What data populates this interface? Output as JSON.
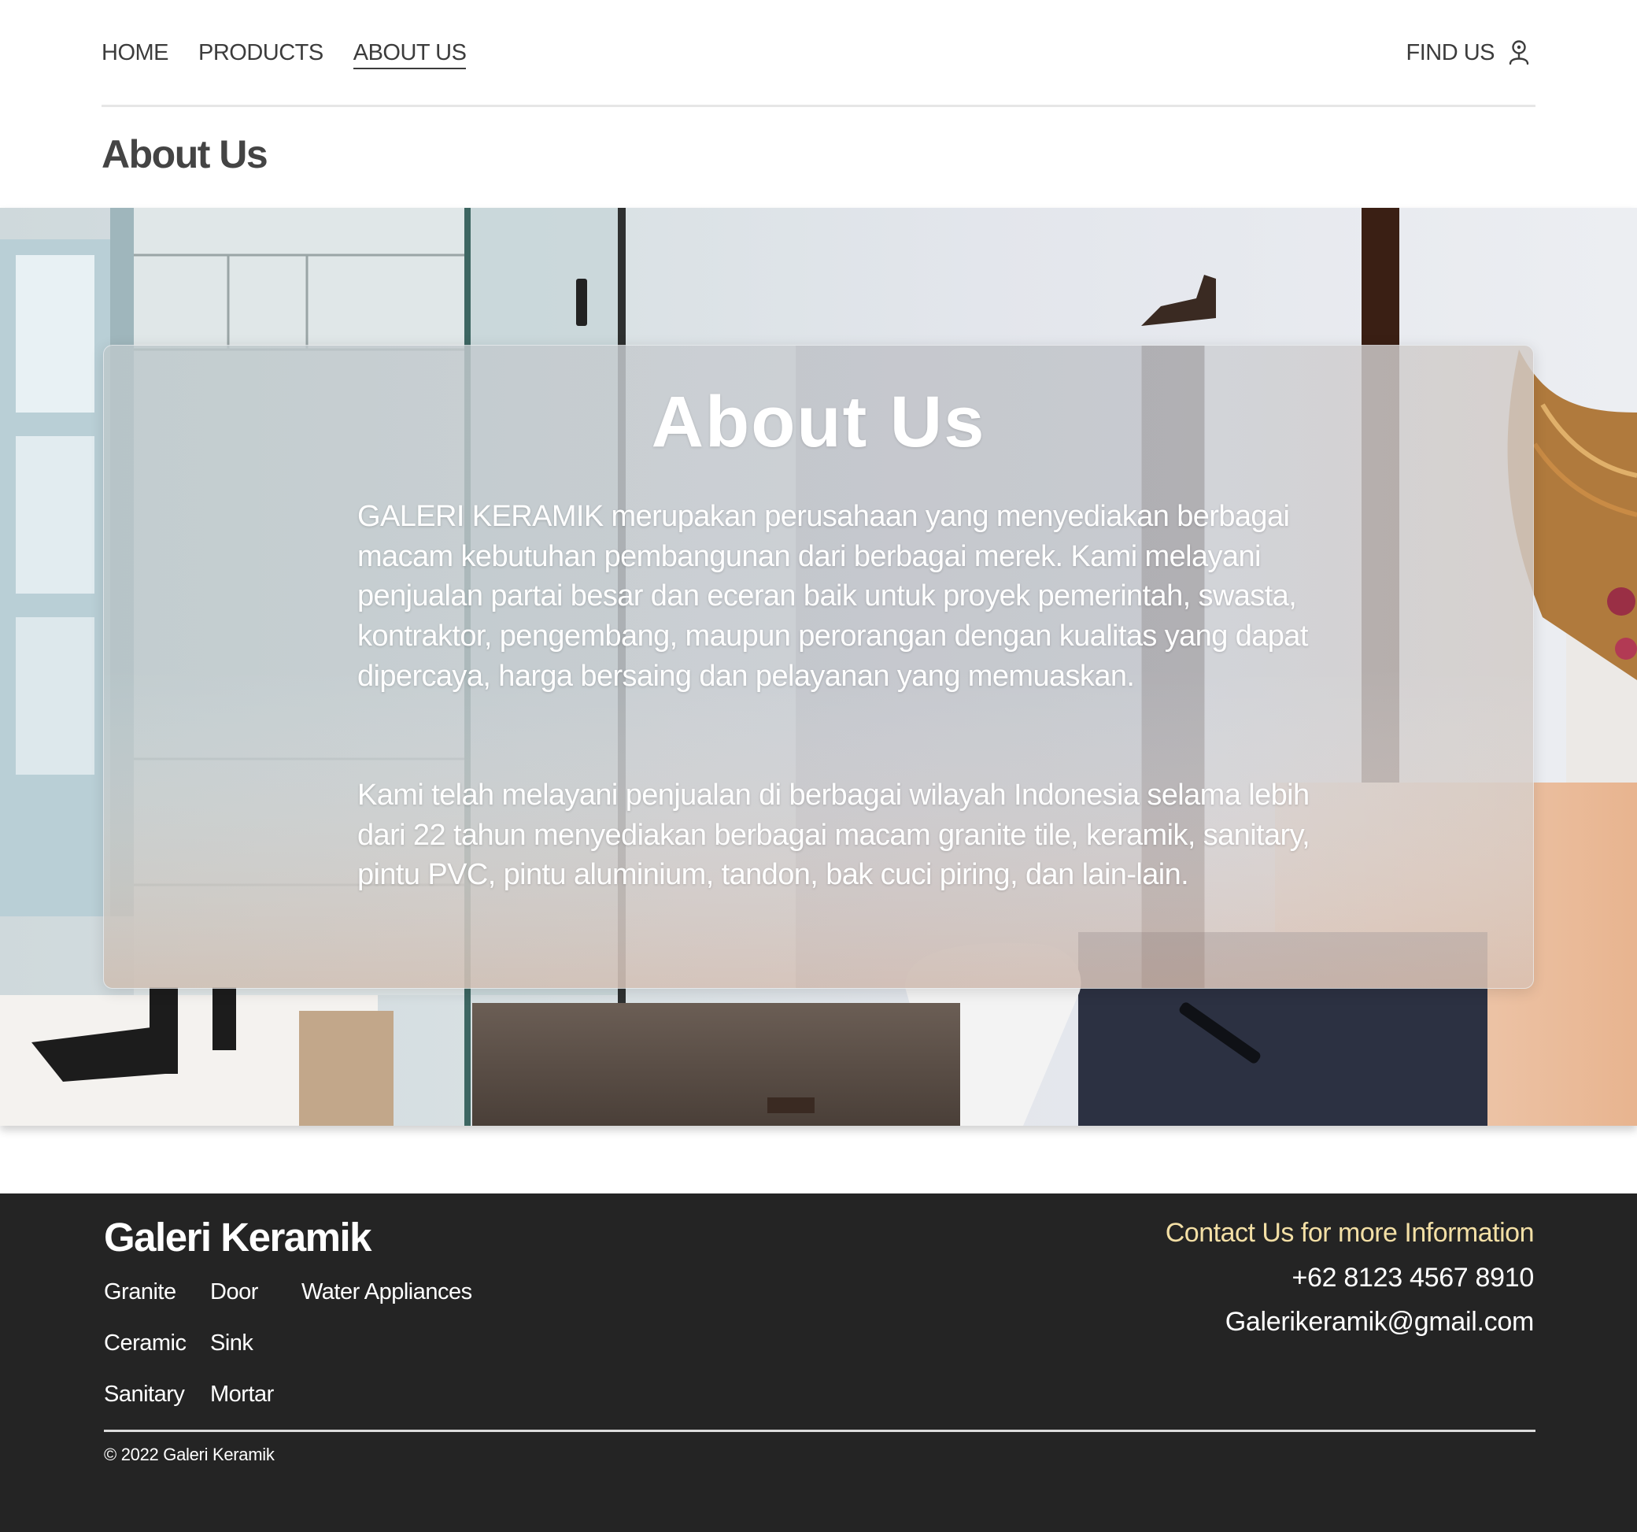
{
  "nav": {
    "links": [
      "HOME",
      "PRODUCTS",
      "ABOUT US"
    ],
    "active_link": "ABOUT US",
    "find_us_label": "FIND US",
    "find_us_icon": "map-pin-user-icon"
  },
  "page_title": "About Us",
  "hero": {
    "title": "About Us",
    "paragraph_1": "GALERI KERAMIK merupakan perusahaan yang menyediakan berbagai macam kebutuhan pembangunan dari berbagai merek. Kami melayani penjualan partai besar dan eceran baik untuk proyek pemerintah, swasta, kontraktor, pengembang, maupun perorangan dengan kualitas yang dapat dipercaya, harga bersaing dan pelayanan yang memuaskan.",
    "paragraph_2": "Kami telah melayani penjualan di berbagai wilayah Indonesia selama lebih dari 22 tahun menyediakan berbagai macam granite tile, keramik, sanitary, pintu PVC, pintu aluminium, tandon, bak cuci piring, dan lain-lain."
  },
  "footer": {
    "brand": "Galeri Keramik",
    "categories": {
      "granite": "Granite",
      "door": "Door",
      "water_appliances": "Water Appliances",
      "ceramic": "Ceramic",
      "sink": "Sink",
      "sanitary": "Sanitary",
      "mortar": "Mortar"
    },
    "contact_title": "Contact Us for more Information",
    "phone": "+62 8123 4567 8910",
    "email": "Galerikeramik@gmail.com",
    "copyright": "© 2022 Galeri Keramik"
  },
  "colors": {
    "nav_text": "#3c3c3c",
    "footer_bg": "#242424",
    "contact_accent": "#f3dfa5"
  }
}
